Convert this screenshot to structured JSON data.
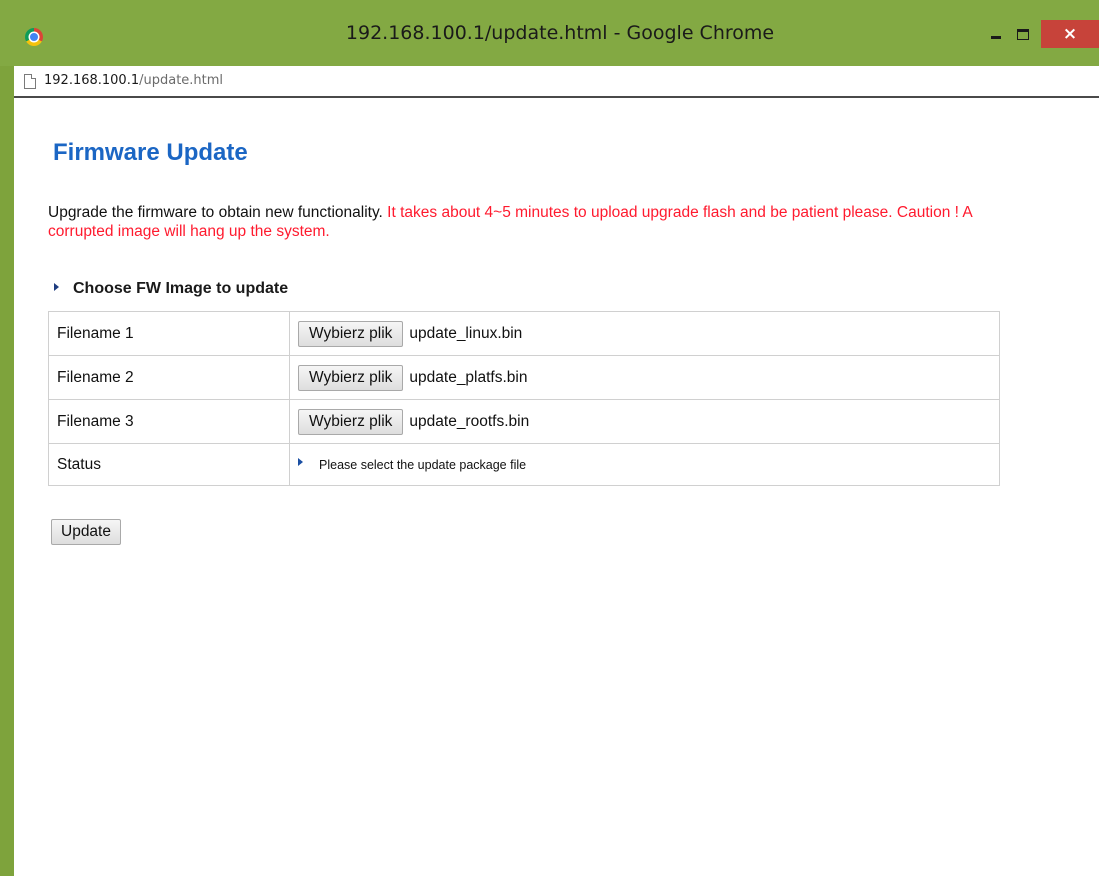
{
  "window": {
    "title": "192.168.100.1/update.html - Google Chrome",
    "close_glyph": "×",
    "icons": {
      "app": "chrome-icon",
      "minimize": "minimize-icon",
      "maximize": "maximize-icon",
      "close": "close-icon"
    }
  },
  "address": {
    "host": "192.168.100.1",
    "path": "/update.html",
    "icon": "page-icon"
  },
  "page": {
    "heading": "Firmware Update",
    "description": "Upgrade the firmware to obtain new functionality.",
    "warning": " It takes about 4~5 minutes to upload upgrade flash and be patient please. Caution !   A corrupted image will hang up the system.",
    "section_title": "Choose FW Image to update",
    "rows": [
      {
        "label": "Filename 1",
        "button": "Wybierz plik",
        "file": "update_linux.bin"
      },
      {
        "label": "Filename 2",
        "button": "Wybierz plik",
        "file": "update_platfs.bin"
      },
      {
        "label": "Filename 3",
        "button": "Wybierz plik",
        "file": "update_rootfs.bin"
      }
    ],
    "status": {
      "label": "Status",
      "text": "Please select the update package file"
    },
    "update_button": "Update"
  },
  "colors": {
    "heading": "#1b66c4",
    "warning": "#ff1a2e",
    "titlebar": "#83a943",
    "close_button": "#c7433a"
  }
}
